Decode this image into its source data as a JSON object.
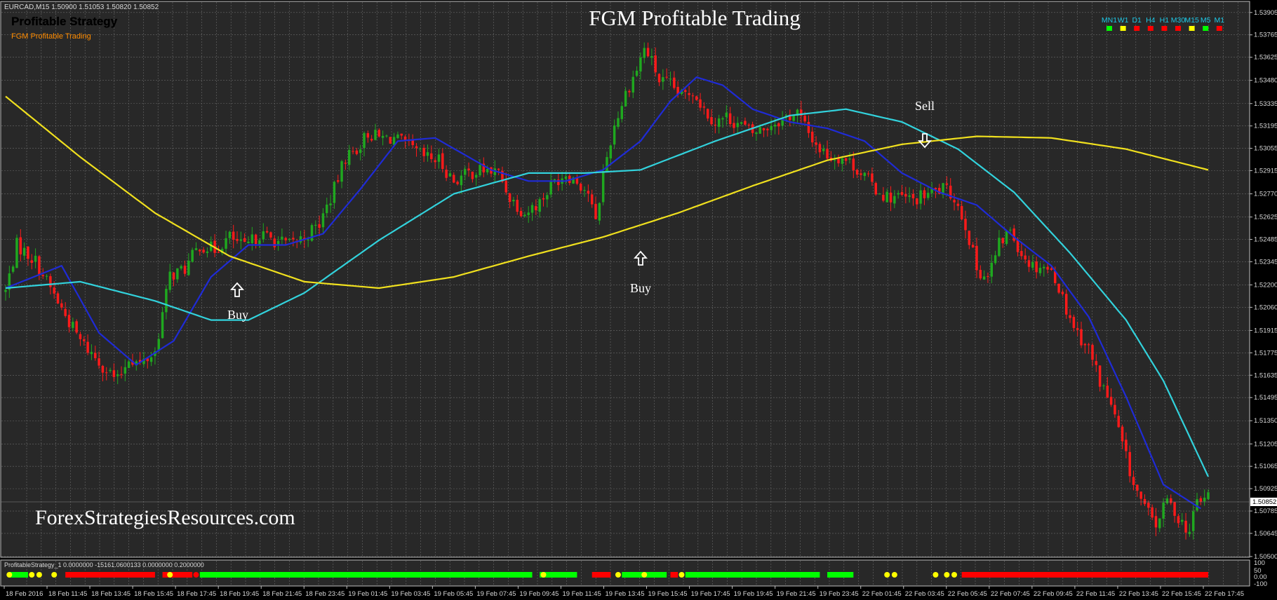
{
  "header": {
    "symbol_info": "EURCAD,M15  1.50900 1.51053 1.50820 1.50852",
    "strategy_title": "Profitable Strategy",
    "strategy_subtitle": "FGM Profitable Trading",
    "chart_title": "FGM Profitable Trading",
    "watermark": "ForexStrategiesResources.com"
  },
  "indicator": {
    "label": "ProfitableStrategy_1 0.0000000 -15161.0600133 0.0000000 0.2000000"
  },
  "timeframes": [
    {
      "label": "MN1",
      "status": "green"
    },
    {
      "label": "W1",
      "status": "yellow"
    },
    {
      "label": "D1",
      "status": "red"
    },
    {
      "label": "H4",
      "status": "red"
    },
    {
      "label": "H1",
      "status": "red"
    },
    {
      "label": "M30",
      "status": "red"
    },
    {
      "label": "M15",
      "status": "yellow"
    },
    {
      "label": "M5",
      "status": "green"
    },
    {
      "label": "M1",
      "status": "red"
    }
  ],
  "annotations": [
    {
      "text": "Buy",
      "arrow": "up"
    },
    {
      "text": "Buy",
      "arrow": "up"
    },
    {
      "text": "Sell",
      "arrow": "down"
    }
  ],
  "colors": {
    "background": "#000000",
    "plot": "#282828",
    "grid": "#6a6a6a",
    "bull": "#1fa81f",
    "bear": "#ff1a1a",
    "fast_ma": "#1f2bd6",
    "mid_ma": "#32d2dc",
    "slow_ma": "#f0e01e",
    "signal_green": "#00ff00",
    "signal_red": "#ff0000",
    "signal_yellow": "#ffff00"
  },
  "chart_data": {
    "type": "candlestick",
    "symbol": "EURCAD",
    "timeframe": "M15",
    "price_axis_ticks": [
      "1.53905",
      "1.53765",
      "1.53625",
      "1.53480",
      "1.53335",
      "1.53195",
      "1.53055",
      "1.52915",
      "1.52770",
      "1.52625",
      "1.52485",
      "1.52345",
      "1.52200",
      "1.52060",
      "1.51915",
      "1.51775",
      "1.51635",
      "1.51495",
      "1.51350",
      "1.51205",
      "1.51065",
      "1.50925",
      "1.50785",
      "1.50645",
      "1.50500"
    ],
    "current_price": "1.50852",
    "ylim": [
      1.505,
      1.5397
    ],
    "time_axis_ticks": [
      "18 Feb 2016",
      "18 Feb 11:45",
      "18 Feb 13:45",
      "18 Feb 15:45",
      "18 Feb 17:45",
      "18 Feb 19:45",
      "18 Feb 21:45",
      "18 Feb 23:45",
      "19 Feb 01:45",
      "19 Feb 03:45",
      "19 Feb 05:45",
      "19 Feb 07:45",
      "19 Feb 09:45",
      "19 Feb 11:45",
      "19 Feb 13:45",
      "19 Feb 15:45",
      "19 Feb 17:45",
      "19 Feb 19:45",
      "19 Feb 21:45",
      "19 Feb 23:45",
      "22 Feb 01:45",
      "22 Feb 03:45",
      "22 Feb 05:45",
      "22 Feb 07:45",
      "22 Feb 09:45",
      "22 Feb 11:45",
      "22 Feb 13:45",
      "22 Feb 15:45",
      "22 Feb 17:45"
    ],
    "close_anchors": [
      [
        0,
        1.5216
      ],
      [
        3,
        1.5245
      ],
      [
        8,
        1.5235
      ],
      [
        12,
        1.5218
      ],
      [
        15,
        1.5205
      ],
      [
        20,
        1.5185
      ],
      [
        25,
        1.5172
      ],
      [
        30,
        1.516
      ],
      [
        33,
        1.5175
      ],
      [
        36,
        1.517
      ],
      [
        40,
        1.5178
      ],
      [
        44,
        1.5226
      ],
      [
        48,
        1.523
      ],
      [
        52,
        1.5245
      ],
      [
        56,
        1.5242
      ],
      [
        60,
        1.525
      ],
      [
        64,
        1.5243
      ],
      [
        68,
        1.5252
      ],
      [
        72,
        1.5248
      ],
      [
        76,
        1.5245
      ],
      [
        80,
        1.525
      ],
      [
        84,
        1.5258
      ],
      [
        88,
        1.528
      ],
      [
        91,
        1.53
      ],
      [
        94,
        1.5305
      ],
      [
        97,
        1.5315
      ],
      [
        100,
        1.5312
      ],
      [
        104,
        1.5312
      ],
      [
        108,
        1.5306
      ],
      [
        112,
        1.53
      ],
      [
        116,
        1.5298
      ],
      [
        120,
        1.5285
      ],
      [
        124,
        1.529
      ],
      [
        128,
        1.5292
      ],
      [
        132,
        1.529
      ],
      [
        135,
        1.5275
      ],
      [
        139,
        1.5265
      ],
      [
        143,
        1.5272
      ],
      [
        147,
        1.5285
      ],
      [
        150,
        1.529
      ],
      [
        153,
        1.5285
      ],
      [
        156,
        1.5278
      ],
      [
        158,
        1.5258
      ],
      [
        160,
        1.529
      ],
      [
        163,
        1.532
      ],
      [
        166,
        1.534
      ],
      [
        169,
        1.5355
      ],
      [
        171,
        1.5368
      ],
      [
        173,
        1.536
      ],
      [
        175,
        1.5348
      ],
      [
        178,
        1.5345
      ],
      [
        181,
        1.5338
      ],
      [
        184,
        1.5342
      ],
      [
        187,
        1.533
      ],
      [
        190,
        1.5322
      ],
      [
        193,
        1.5325
      ],
      [
        197,
        1.532
      ],
      [
        200,
        1.5315
      ],
      [
        203,
        1.5318
      ],
      [
        206,
        1.5322
      ],
      [
        209,
        1.5325
      ],
      [
        212,
        1.5328
      ],
      [
        215,
        1.5315
      ],
      [
        218,
        1.5305
      ],
      [
        221,
        1.53
      ],
      [
        224,
        1.53
      ],
      [
        227,
        1.5295
      ],
      [
        230,
        1.5288
      ],
      [
        233,
        1.528
      ],
      [
        236,
        1.5275
      ],
      [
        239,
        1.5275
      ],
      [
        243,
        1.5273
      ],
      [
        247,
        1.5277
      ],
      [
        251,
        1.528
      ],
      [
        254,
        1.5275
      ],
      [
        257,
        1.5258
      ],
      [
        260,
        1.523
      ],
      [
        263,
        1.5225
      ],
      [
        266,
        1.5245
      ],
      [
        269,
        1.5255
      ],
      [
        272,
        1.524
      ],
      [
        275,
        1.5232
      ],
      [
        278,
        1.5232
      ],
      [
        281,
        1.5225
      ],
      [
        284,
        1.5205
      ],
      [
        287,
        1.519
      ],
      [
        290,
        1.518
      ],
      [
        293,
        1.516
      ],
      [
        296,
        1.5145
      ],
      [
        299,
        1.512
      ],
      [
        302,
        1.5095
      ],
      [
        305,
        1.508
      ],
      [
        308,
        1.507
      ],
      [
        311,
        1.5085
      ],
      [
        314,
        1.5075
      ],
      [
        317,
        1.5065
      ],
      [
        319,
        1.5085
      ],
      [
        322,
        1.5088
      ]
    ],
    "series": [
      {
        "name": "",
        "role": "fast_ma",
        "points": [
          [
            0,
            1.5218
          ],
          [
            15,
            1.5232
          ],
          [
            25,
            1.519
          ],
          [
            35,
            1.517
          ],
          [
            45,
            1.5185
          ],
          [
            55,
            1.5225
          ],
          [
            65,
            1.5245
          ],
          [
            75,
            1.5245
          ],
          [
            85,
            1.5252
          ],
          [
            95,
            1.528
          ],
          [
            105,
            1.531
          ],
          [
            115,
            1.5312
          ],
          [
            130,
            1.5292
          ],
          [
            140,
            1.5285
          ],
          [
            150,
            1.5285
          ],
          [
            160,
            1.5292
          ],
          [
            170,
            1.531
          ],
          [
            178,
            1.5335
          ],
          [
            185,
            1.535
          ],
          [
            192,
            1.5345
          ],
          [
            200,
            1.533
          ],
          [
            210,
            1.5322
          ],
          [
            220,
            1.5318
          ],
          [
            230,
            1.531
          ],
          [
            240,
            1.529
          ],
          [
            250,
            1.5278
          ],
          [
            260,
            1.527
          ],
          [
            270,
            1.525
          ],
          [
            280,
            1.5232
          ],
          [
            290,
            1.52
          ],
          [
            300,
            1.515
          ],
          [
            310,
            1.5095
          ],
          [
            320,
            1.508
          ]
        ]
      },
      {
        "name": "",
        "role": "mid_ma",
        "points": [
          [
            0,
            1.5218
          ],
          [
            20,
            1.5222
          ],
          [
            40,
            1.521
          ],
          [
            55,
            1.5198
          ],
          [
            65,
            1.5198
          ],
          [
            80,
            1.5215
          ],
          [
            100,
            1.5248
          ],
          [
            120,
            1.5277
          ],
          [
            140,
            1.529
          ],
          [
            155,
            1.529
          ],
          [
            170,
            1.5292
          ],
          [
            190,
            1.531
          ],
          [
            210,
            1.5326
          ],
          [
            225,
            1.533
          ],
          [
            240,
            1.5322
          ],
          [
            255,
            1.5305
          ],
          [
            270,
            1.5278
          ],
          [
            285,
            1.524
          ],
          [
            300,
            1.5198
          ],
          [
            310,
            1.516
          ],
          [
            322,
            1.51
          ]
        ]
      },
      {
        "name": "",
        "role": "slow_ma",
        "points": [
          [
            0,
            1.5338
          ],
          [
            20,
            1.53
          ],
          [
            40,
            1.5265
          ],
          [
            60,
            1.5238
          ],
          [
            80,
            1.5222
          ],
          [
            100,
            1.5218
          ],
          [
            120,
            1.5225
          ],
          [
            140,
            1.5238
          ],
          [
            160,
            1.525
          ],
          [
            180,
            1.5265
          ],
          [
            200,
            1.5282
          ],
          [
            220,
            1.5298
          ],
          [
            240,
            1.5308
          ],
          [
            260,
            1.5313
          ],
          [
            280,
            1.5312
          ],
          [
            300,
            1.5305
          ],
          [
            322,
            1.5292
          ]
        ]
      }
    ]
  }
}
